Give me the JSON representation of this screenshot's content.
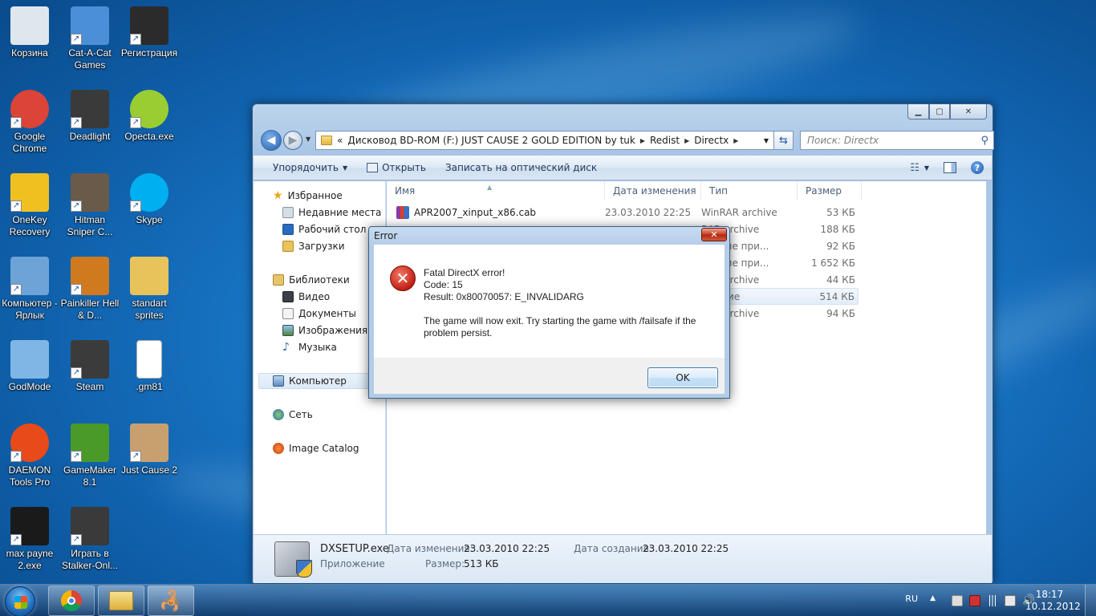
{
  "desktop": {
    "icons": [
      {
        "label": "Корзина",
        "icon": "recycle-bin-icon",
        "color": "#dfe7ee"
      },
      {
        "label": "Cat-A-Cat Games",
        "icon": "cat-a-cat-icon",
        "color": "#4a8fd8"
      },
      {
        "label": "Регистрация",
        "icon": "registration-icon",
        "color": "#2b2b2b"
      },
      {
        "label": "Google Chrome",
        "icon": "chrome-icon",
        "color": "#db4437"
      },
      {
        "label": "Deadlight",
        "icon": "deadlight-icon",
        "color": "#3a3a3a"
      },
      {
        "label": "Opecta.exe",
        "icon": "opecta-icon",
        "color": "#9acd32"
      },
      {
        "label": "OneKey Recovery",
        "icon": "onekey-recovery-icon",
        "color": "#f0c020"
      },
      {
        "label": "Hitman Sniper C...",
        "icon": "hitman-icon",
        "color": "#6a5a4a"
      },
      {
        "label": "Skype",
        "icon": "skype-icon",
        "color": "#00aff0"
      },
      {
        "label": "Компьютер - Ярлык",
        "icon": "computer-icon",
        "color": "#6ea3d8"
      },
      {
        "label": "Painkiller Hell & D...",
        "icon": "painkiller-icon",
        "color": "#d07a20"
      },
      {
        "label": "standart sprites",
        "icon": "folder-icon",
        "color": "#e8c25a"
      },
      {
        "label": "GodMode",
        "icon": "godmode-icon",
        "color": "#7fb6e6"
      },
      {
        "label": "Steam",
        "icon": "steam-icon",
        "color": "#3b3b3b"
      },
      {
        "label": ".gm81",
        "icon": "blank-file-icon",
        "color": "#ffffff"
      },
      {
        "label": "DAEMON Tools Pro",
        "icon": "daemon-tools-icon",
        "color": "#e84a1a"
      },
      {
        "label": "GameMaker 8.1",
        "icon": "gamemaker-icon",
        "color": "#4a9a2a"
      },
      {
        "label": "Just Cause 2",
        "icon": "just-cause-2-icon",
        "color": "#c8a070"
      },
      {
        "label": "max payne 2.exe",
        "icon": "max-payne-icon",
        "color": "#1a1a1a"
      },
      {
        "label": "Играть в Stalker-Onl...",
        "icon": "stalker-icon",
        "color": "#3a3a3a"
      }
    ]
  },
  "explorer": {
    "address": {
      "chevron": "«",
      "parts": [
        "Дисковод BD-ROM (F:) JUST CAUSE 2 GOLD EDITION by tuk",
        "Redist",
        "Directx"
      ]
    },
    "search_placeholder": "Поиск: Directx",
    "toolbar": {
      "organize": "Упорядочить",
      "open": "Открыть",
      "burn": "Записать на оптический диск"
    },
    "nav": {
      "favorites": "Избранное",
      "recent": "Недавние места",
      "desktop": "Рабочий стол",
      "downloads": "Загрузки",
      "libraries": "Библиотеки",
      "video": "Видео",
      "documents": "Документы",
      "images": "Изображения",
      "music": "Музыка",
      "computer": "Компьютер",
      "network": "Сеть",
      "image_catalog": "Image Catalog"
    },
    "columns": {
      "name": "Имя",
      "date": "Дата изменения",
      "type": "Тип",
      "size": "Размер"
    },
    "files": [
      {
        "name": "APR2007_xinput_x86.cab",
        "date": "23.03.2010 22:25",
        "type": "WinRAR archive",
        "size": "53 КБ"
      },
      {
        "name": "",
        "date": "",
        "type": "RAR archive",
        "size": "188 КБ"
      },
      {
        "name": "",
        "date": "",
        "type": "ирение при...",
        "size": "92 КБ"
      },
      {
        "name": "",
        "date": "",
        "type": "ирение при...",
        "size": "1 652 КБ"
      },
      {
        "name": "",
        "date": "",
        "type": "RAR archive",
        "size": "44 КБ"
      },
      {
        "name": "",
        "date": "",
        "type": "ожение",
        "size": "514 КБ"
      },
      {
        "name": "",
        "date": "",
        "type": "RAR archive",
        "size": "94 КБ"
      }
    ],
    "details": {
      "filename": "DXSETUP.exe",
      "filetype": "Приложение",
      "modified_label": "Дата изменения:",
      "modified_value": "23.03.2010 22:25",
      "size_label": "Размер:",
      "size_value": "513 КБ",
      "created_label": "Дата создания:",
      "created_value": "23.03.2010 22:25"
    }
  },
  "dialog": {
    "title": "Error",
    "line1": "Fatal DirectX error!",
    "line2": "Code: 15",
    "line3": "Result: 0x80070057: E_INVALIDARG",
    "line4": "The game will now exit. Try starting the game with /failsafe if the problem persist.",
    "ok": "OK"
  },
  "taskbar": {
    "lang": "RU",
    "time": "18:17",
    "date": "10.12.2012",
    "apps": [
      "chrome-icon",
      "explorer-icon",
      "scorpion-app-icon"
    ]
  }
}
